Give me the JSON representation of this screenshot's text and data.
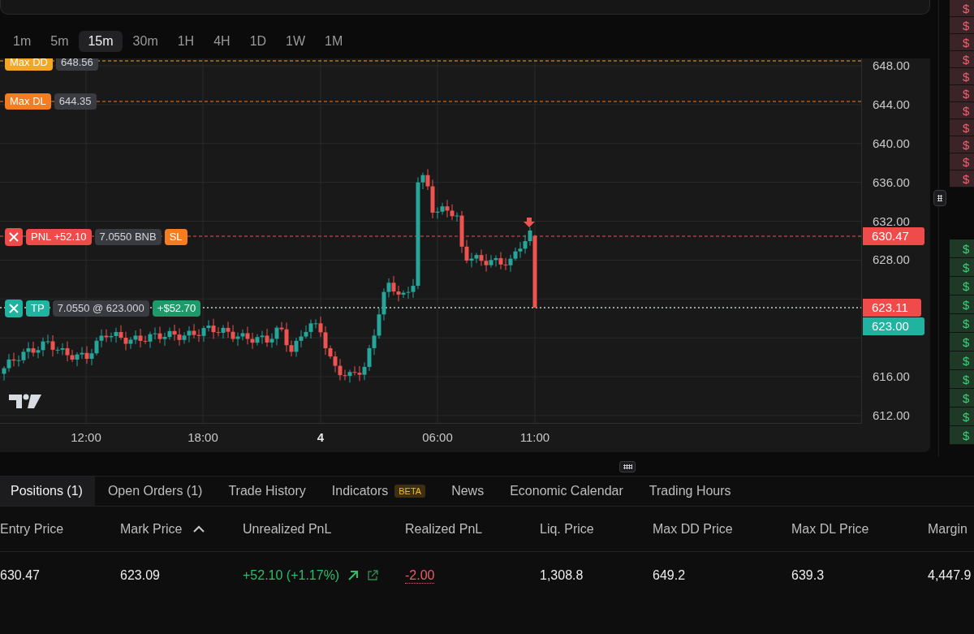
{
  "timeframes": [
    {
      "label": "1m",
      "selected": false
    },
    {
      "label": "5m",
      "selected": false
    },
    {
      "label": "15m",
      "selected": true
    },
    {
      "label": "30m",
      "selected": false
    },
    {
      "label": "1H",
      "selected": false
    },
    {
      "label": "4H",
      "selected": false
    },
    {
      "label": "1D",
      "selected": false
    },
    {
      "label": "1W",
      "selected": false
    },
    {
      "label": "1M",
      "selected": false
    }
  ],
  "chart": {
    "levels": [
      {
        "kind": "max_dd",
        "label": "Max DD",
        "value": "648.56"
      },
      {
        "kind": "max_dl",
        "label": "Max DL",
        "value": "644.35"
      }
    ],
    "position_line": {
      "pnl": "PNL +52.10",
      "size": "7.0550 BNB",
      "sl": "SL"
    },
    "tp_line": {
      "label": "TP",
      "order": "7.0550 @ 623.000",
      "profit": "+$52.70"
    },
    "price_ticks_upper": [
      "648.00",
      "644.00",
      "640.00",
      "636.00",
      "632.00",
      "628.00"
    ],
    "price_ticks_lower": [
      "616.00",
      "612.00"
    ],
    "price_tags": [
      {
        "kind": "entry",
        "text": "630.47"
      },
      {
        "kind": "last",
        "text": "623.11"
      },
      {
        "kind": "tp",
        "text": "623.00"
      }
    ],
    "time_labels": [
      {
        "kind": "time",
        "text": "12:00"
      },
      {
        "kind": "time",
        "text": "18:00"
      },
      {
        "kind": "day",
        "text": "4"
      },
      {
        "kind": "time",
        "text": "06:00"
      },
      {
        "kind": "time",
        "text": "11:00"
      }
    ]
  },
  "bottom_tabs": [
    {
      "label": "Positions (1)",
      "selected": true
    },
    {
      "label": "Open Orders (1)",
      "selected": false
    },
    {
      "label": "Trade History",
      "selected": false
    },
    {
      "label": "Indicators",
      "badge": "BETA",
      "selected": false
    },
    {
      "label": "News",
      "selected": false
    },
    {
      "label": "Economic Calendar",
      "selected": false
    },
    {
      "label": "Trading Hours",
      "selected": false
    }
  ],
  "table": {
    "columns": [
      {
        "label": "Entry Price",
        "sorted": false
      },
      {
        "label": "Mark Price",
        "sorted": true
      },
      {
        "label": "Unrealized PnL",
        "sorted": false
      },
      {
        "label": "Realized PnL",
        "sorted": false
      },
      {
        "label": "Liq. Price",
        "sorted": false
      },
      {
        "label": "Max DD Price",
        "sorted": false
      },
      {
        "label": "Max DL Price",
        "sorted": false
      },
      {
        "label": "Margin",
        "sorted": false
      }
    ],
    "rows": [
      [
        {
          "kind": "plain",
          "text": "630.47"
        },
        {
          "kind": "plain",
          "text": "623.09"
        },
        {
          "kind": "profit",
          "text": "+52.10 (+1.17%)"
        },
        {
          "kind": "loss",
          "text": "-2.00"
        },
        {
          "kind": "plain",
          "text": "1,308.8"
        },
        {
          "kind": "plain",
          "text": "649.2"
        },
        {
          "kind": "plain",
          "text": "639.3"
        },
        {
          "kind": "plain",
          "text": "4,447.9"
        }
      ]
    ]
  },
  "order_book": {
    "asks": [
      "$",
      "$",
      "$",
      "$",
      "$",
      "$",
      "$",
      "$",
      "$",
      "$",
      "$"
    ],
    "bids": [
      "$",
      "$",
      "$",
      "$",
      "$",
      "$",
      "$",
      "$",
      "$",
      "$",
      "$"
    ]
  }
}
